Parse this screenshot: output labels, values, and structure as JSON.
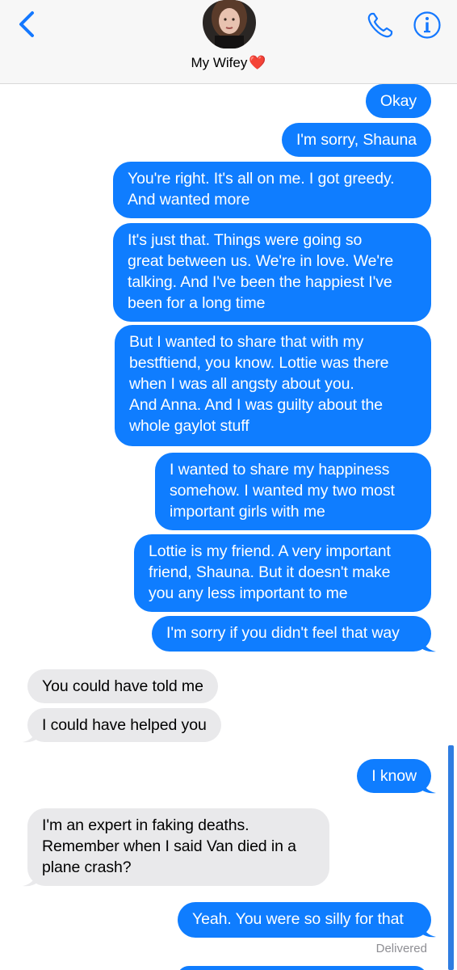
{
  "header": {
    "contact_name": "My Wifey",
    "heart_emoji": "❤️",
    "icons": [
      "chevron-left-icon",
      "avatar",
      "phone-icon",
      "info-icon"
    ],
    "accent_color": "#1478ff"
  },
  "messages": [
    {
      "dir": "out",
      "text": "Okay"
    },
    {
      "dir": "out",
      "text": "I'm sorry, Shauna"
    },
    {
      "dir": "out",
      "text": "You're right. It's all on me. I got greedy.\nAnd wanted more"
    },
    {
      "dir": "out",
      "text": "It's just that. Things were going so\ngreat between us. We're in love. We're\ntalking. And I've been the happiest I've\nbeen for a long time"
    },
    {
      "dir": "out",
      "text": "But I wanted to share that with my\nbestftiend, you know. Lottie was there\nwhen I was all angsty about you.\nAnd Anna. And I was guilty about the\nwhole gaylot stuff"
    },
    {
      "dir": "out",
      "text": "I wanted to share my happiness\nsomehow. I wanted my two most\nimportant girls with me"
    },
    {
      "dir": "out",
      "text": "Lottie is my friend. A very important\nfriend, Shauna. But it doesn't make\nyou any less important to me"
    },
    {
      "dir": "out",
      "text": "I'm sorry if you didn't feel that way"
    },
    {
      "dir": "in",
      "text": "You could have told me"
    },
    {
      "dir": "in",
      "text": "I could have helped you"
    },
    {
      "dir": "out",
      "text": "I know"
    },
    {
      "dir": "in",
      "text": "I'm an expert in faking deaths.\nRemember when I said Van died in a\nplane crash?"
    },
    {
      "dir": "out",
      "text": "Yeah. You were so silly for that"
    }
  ],
  "status": {
    "delivered": "Delivered"
  },
  "colors": {
    "outgoing": "#0f7dff",
    "incoming": "#e9e9eb",
    "scrollbar": "#2f7de1"
  }
}
